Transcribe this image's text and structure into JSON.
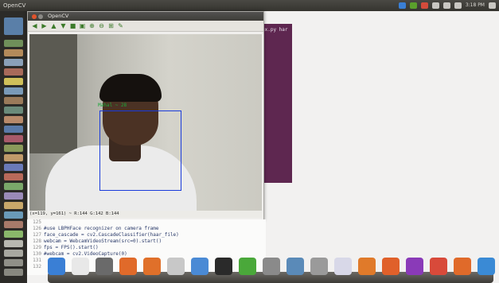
{
  "topbar": {
    "app_name": "OpenCV",
    "clock": "3:18 PM"
  },
  "cv_window": {
    "title": "OpenCV",
    "face_label": "Mahal ~ 28",
    "status": "(x=119, y=161) ~ R:144 G:142 B:144"
  },
  "terminal": {
    "text": "ex.py har"
  },
  "code": {
    "lines": [
      {
        "num": "125",
        "text": ""
      },
      {
        "num": "126",
        "text": "#use LBPHFace recognizer on camera frame"
      },
      {
        "num": "127",
        "text": "face_cascade = cv2.CascadeClassifier(haar_file)"
      },
      {
        "num": "128",
        "text": "webcam = WebcamVideoStream(src=0).start()"
      },
      {
        "num": "129",
        "text": "fps = FPS().start()"
      },
      {
        "num": "130",
        "text": "#webcam = cv2.VideoCapture(0)"
      },
      {
        "num": "131",
        "text": ""
      },
      {
        "num": "132",
        "text": ""
      }
    ]
  },
  "colors": {
    "face_box": "#1a3bdb",
    "face_label": "#1aa83a",
    "terminal_bg": "#5e2750"
  }
}
